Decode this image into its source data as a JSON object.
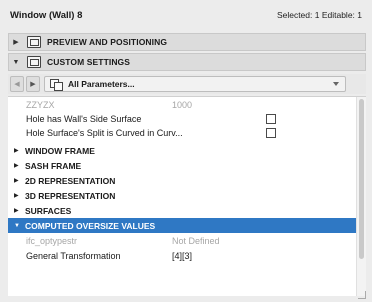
{
  "window": {
    "title": "Window (Wall) 8",
    "selection": "Selected: 1 Editable: 1"
  },
  "sections": {
    "preview": "PREVIEW AND POSITIONING",
    "custom": "CUSTOM SETTINGS"
  },
  "toolbar": {
    "back_icon": "left-arrow",
    "forward_icon": "right-arrow",
    "combo_label": "All Parameters..."
  },
  "params": {
    "zzyzx": {
      "name": "ZZYZX",
      "value": "1000"
    },
    "side_surface": {
      "name": "Hole has Wall's Side Surface",
      "checked": false
    },
    "split_curved": {
      "name": "Hole Surface's Split is Curved in Curv...",
      "checked": false
    },
    "ifc_optypestr": {
      "name": "ifc_optypestr",
      "value": "Not Defined"
    },
    "general_transform": {
      "name": "General Transformation",
      "value": "[4][3]"
    }
  },
  "groups": {
    "window_frame": "WINDOW FRAME",
    "sash_frame": "SASH FRAME",
    "rep_2d": "2D REPRESENTATION",
    "rep_3d": "3D REPRESENTATION",
    "surfaces": "SURFACES",
    "computed": "COMPUTED OVERSIZE VALUES"
  },
  "colors": {
    "selected_row": "#2f78c4",
    "disabled_text": "#a6a6a6"
  }
}
